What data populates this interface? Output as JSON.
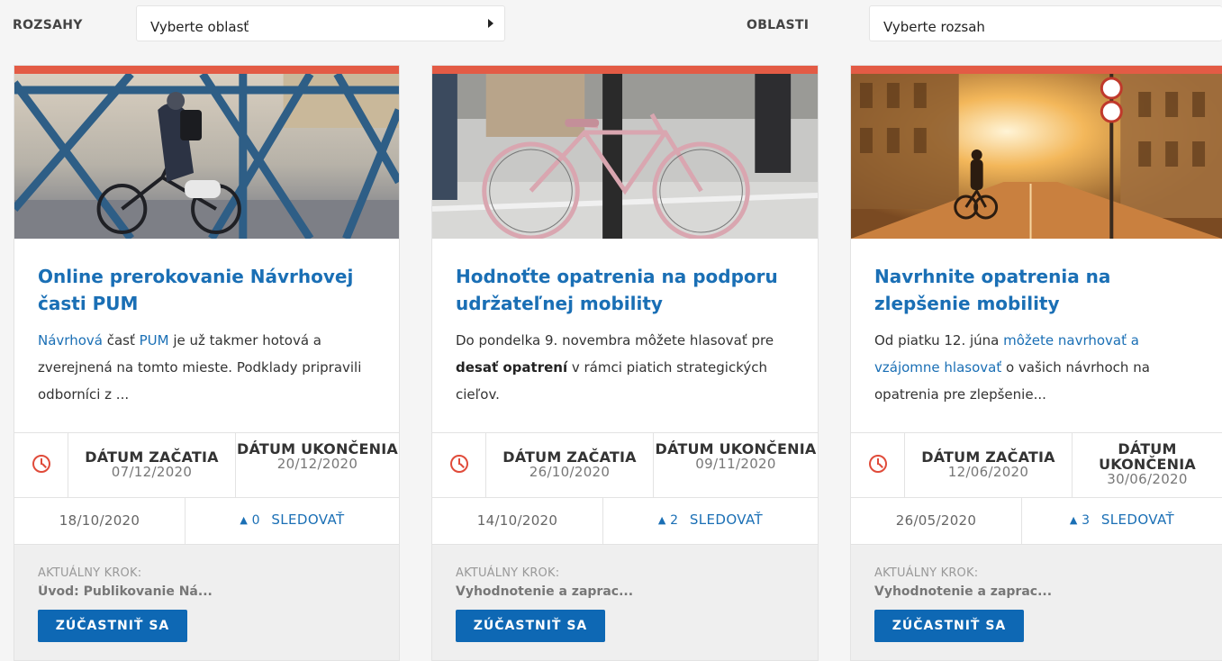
{
  "filters": {
    "scope_label": "ROZSAHY",
    "scope_select": "Vyberte oblasť",
    "area_label": "OBLASTI",
    "area_select": "Vyberte rozsah"
  },
  "colors": {
    "accent_bar": "#e35b45",
    "link_blue": "#1a6fb5",
    "button_blue": "#0e68b4",
    "clock_red": "#e04b3a"
  },
  "cards": [
    {
      "title": "Online prerokovanie Návrhovej časti PUM",
      "desc": {
        "l1": "Návrhová",
        "t1": " časť ",
        "l2": "PUM",
        "t2": " je už takmer hotová a zverejnená na tomto mieste. Podklady pripravili odborníci z ..."
      },
      "start_label": "DÁTUM ZAČATIA",
      "start_date": "07/12/2020",
      "end_label": "DÁTUM UKONČENIA",
      "end_date": "20/12/2020",
      "published": "18/10/2020",
      "followers": "0",
      "follow_label": "SLEDOVAŤ",
      "step_label": "AKTUÁLNY KROK:",
      "step_value": "Úvod: Publikovanie Ná...",
      "button": "ZÚČASTNIŤ SA",
      "image_icon": "cyclist-on-bridge-photo"
    },
    {
      "title": "Hodnoťte opatrenia na podporu udržateľnej mobility",
      "desc": {
        "t1": "Do pondelka 9. novembra môžete hlasovať pre ",
        "b1": "desať opatrení",
        "t2": " v rámci piatich strategických cieľov."
      },
      "start_label": "DÁTUM ZAČATIA",
      "start_date": "26/10/2020",
      "end_label": "DÁTUM UKONČENIA",
      "end_date": "09/11/2020",
      "published": "14/10/2020",
      "followers": "2",
      "follow_label": "SLEDOVAŤ",
      "step_label": "AKTUÁLNY KROK:",
      "step_value": "Vyhodnotenie a zaprac...",
      "button": "ZÚČASTNIŤ SA",
      "image_icon": "parked-bicycle-photo"
    },
    {
      "title": "Navrhnite opatrenia na zlepšenie mobility",
      "desc": {
        "t1": "Od piatku 12. júna ",
        "l1": "môžete navrhovať a vzájomne hlasovať",
        "t2": " o vašich návrhoch na opatrenia pre zlepšenie..."
      },
      "start_label": "DÁTUM ZAČATIA",
      "start_date": "12/06/2020",
      "end_label": "DÁTUM UKONČENIA",
      "end_date": "30/06/2020",
      "published": "26/05/2020",
      "followers": "3",
      "follow_label": "SLEDOVAŤ",
      "step_label": "AKTUÁLNY KROK:",
      "step_value": "Vyhodnotenie a zaprac...",
      "button": "ZÚČASTNIŤ SA",
      "image_icon": "cyclist-sunset-street-photo"
    }
  ]
}
